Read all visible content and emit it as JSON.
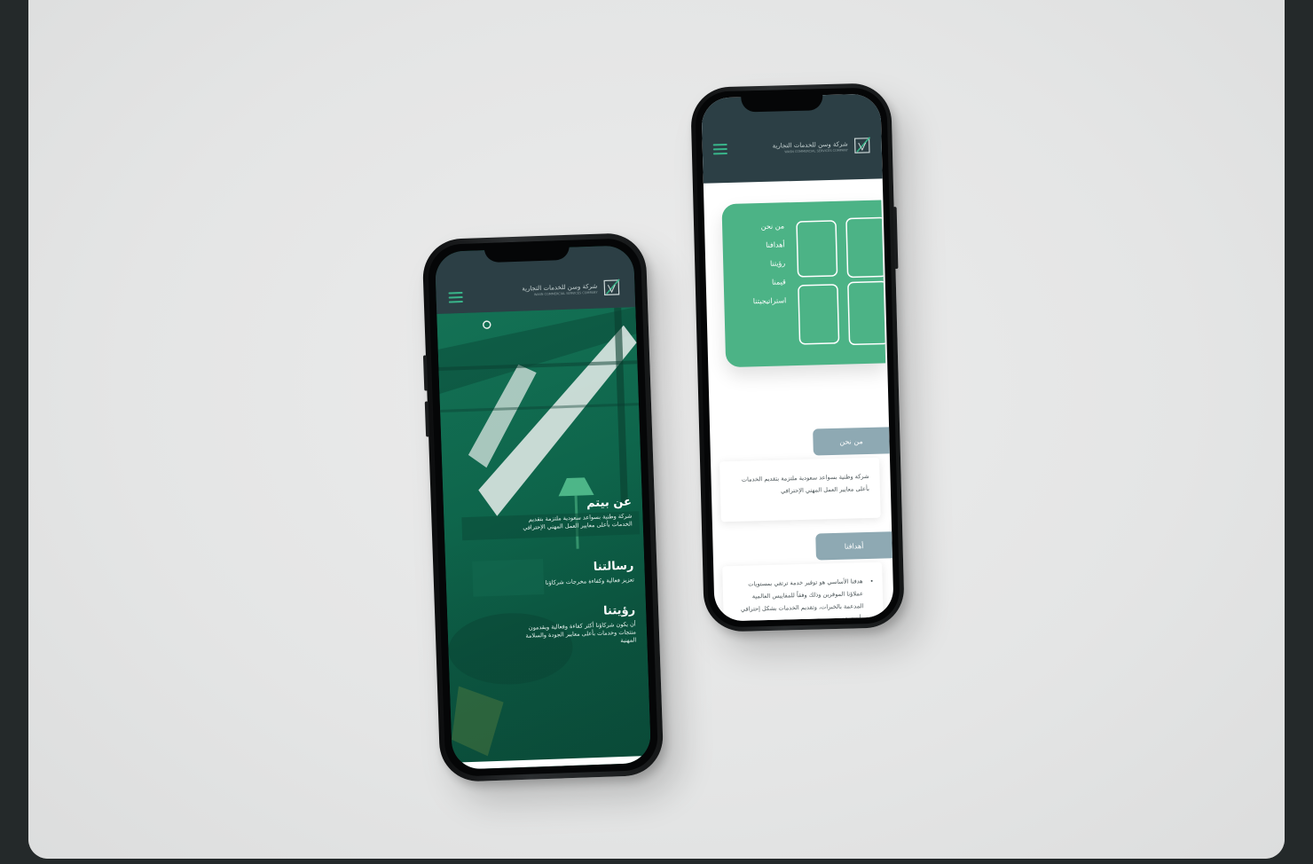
{
  "left_phone": {
    "logo_text": "شركة وسن للخدمات التجارية",
    "logo_subtext": "WASN COMMERCIAL SERVICES COMPANY",
    "sections": [
      {
        "heading": "عن بيتم",
        "body": "شركة وطنية بسواعد سعودية ملتزمة بتقديم الخدمات بأعلى معايير العمل المهني الإحترافي"
      },
      {
        "heading": "رسالتنا",
        "body": "تعزيز فعالية وكفاءة مخرجات شركاؤنا"
      },
      {
        "heading": "رؤيتنا",
        "body": "أن يكون شركاؤنا أكثر كفاءة وفعالية ويقدمون منتجات وخدمات بأعلى معايير الجودة والسلامة المهنية"
      }
    ]
  },
  "right_phone": {
    "logo_text": "شركة وسن للخدمات التجارية",
    "logo_subtext": "WASN COMMERCIAL SERVICES COMPANY",
    "menu_items": [
      "من نحن",
      "أهدافنا",
      "رؤيتنا",
      "قيمنا",
      "استراتيجيتنا"
    ],
    "about": {
      "tag": "من نحن",
      "body": "شركة وطنية بسواعد سعودية ملتزمة بتقديم الخدمات بأعلى معايير العمل المهني الإحترافي"
    },
    "goals": {
      "tag": "أهدافنا",
      "bullet": "هدفنا الأساسي هو توفير خدمة ترتقي بمستويات عملاؤنا الموقرين وذلك وفقاً للمقاييس العالمية المدعمة بالخبرات، وتقديم الخدمات بشكل إحترافي وأن نحقق"
    }
  },
  "colors": {
    "canvas": "#e6e7e7",
    "header": "#2c3f45",
    "accent": "#4cb386",
    "tag": "#8ea9b3",
    "hero_green": "#0f6a4f"
  },
  "icons": {
    "menu": "hamburger-icon",
    "logo": "logo-mark-icon"
  }
}
